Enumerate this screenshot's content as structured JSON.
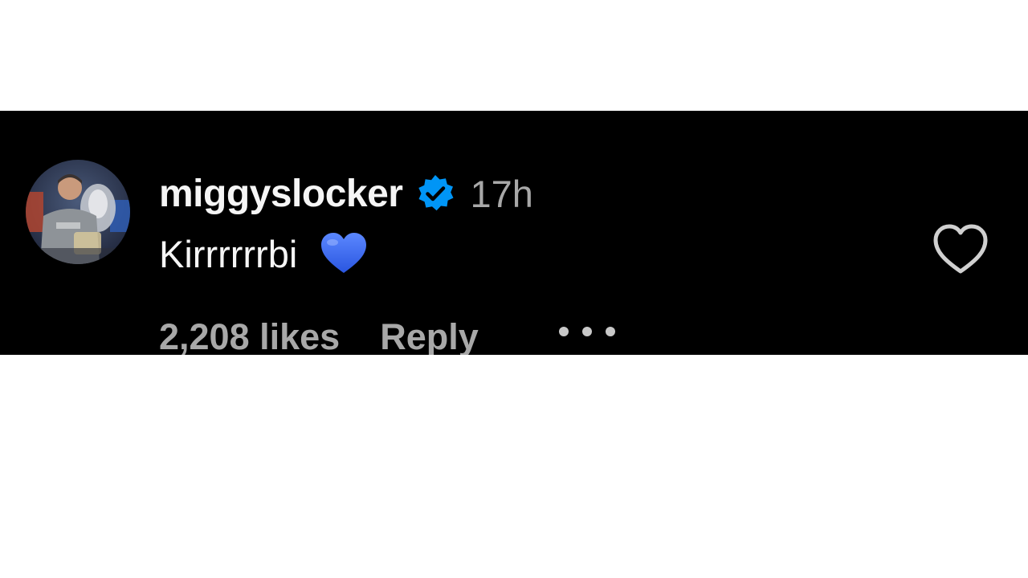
{
  "comment": {
    "username": "miggyslocker",
    "verified_icon": "verified-badge-icon",
    "timestamp": "17h",
    "text": "Kirrrrrrbi",
    "emoji": "blue-heart-emoji",
    "likes": "2,208 likes",
    "reply_label": "Reply",
    "more_icon": "more-options-icon",
    "like_icon": "heart-outline-icon"
  },
  "colors": {
    "band_background": "#000000",
    "primary_text": "#f5f5f5",
    "secondary_text": "#a8a8a8",
    "verified_blue": "#0095f6",
    "heart_emoji_blue": "#3b6cf5"
  }
}
